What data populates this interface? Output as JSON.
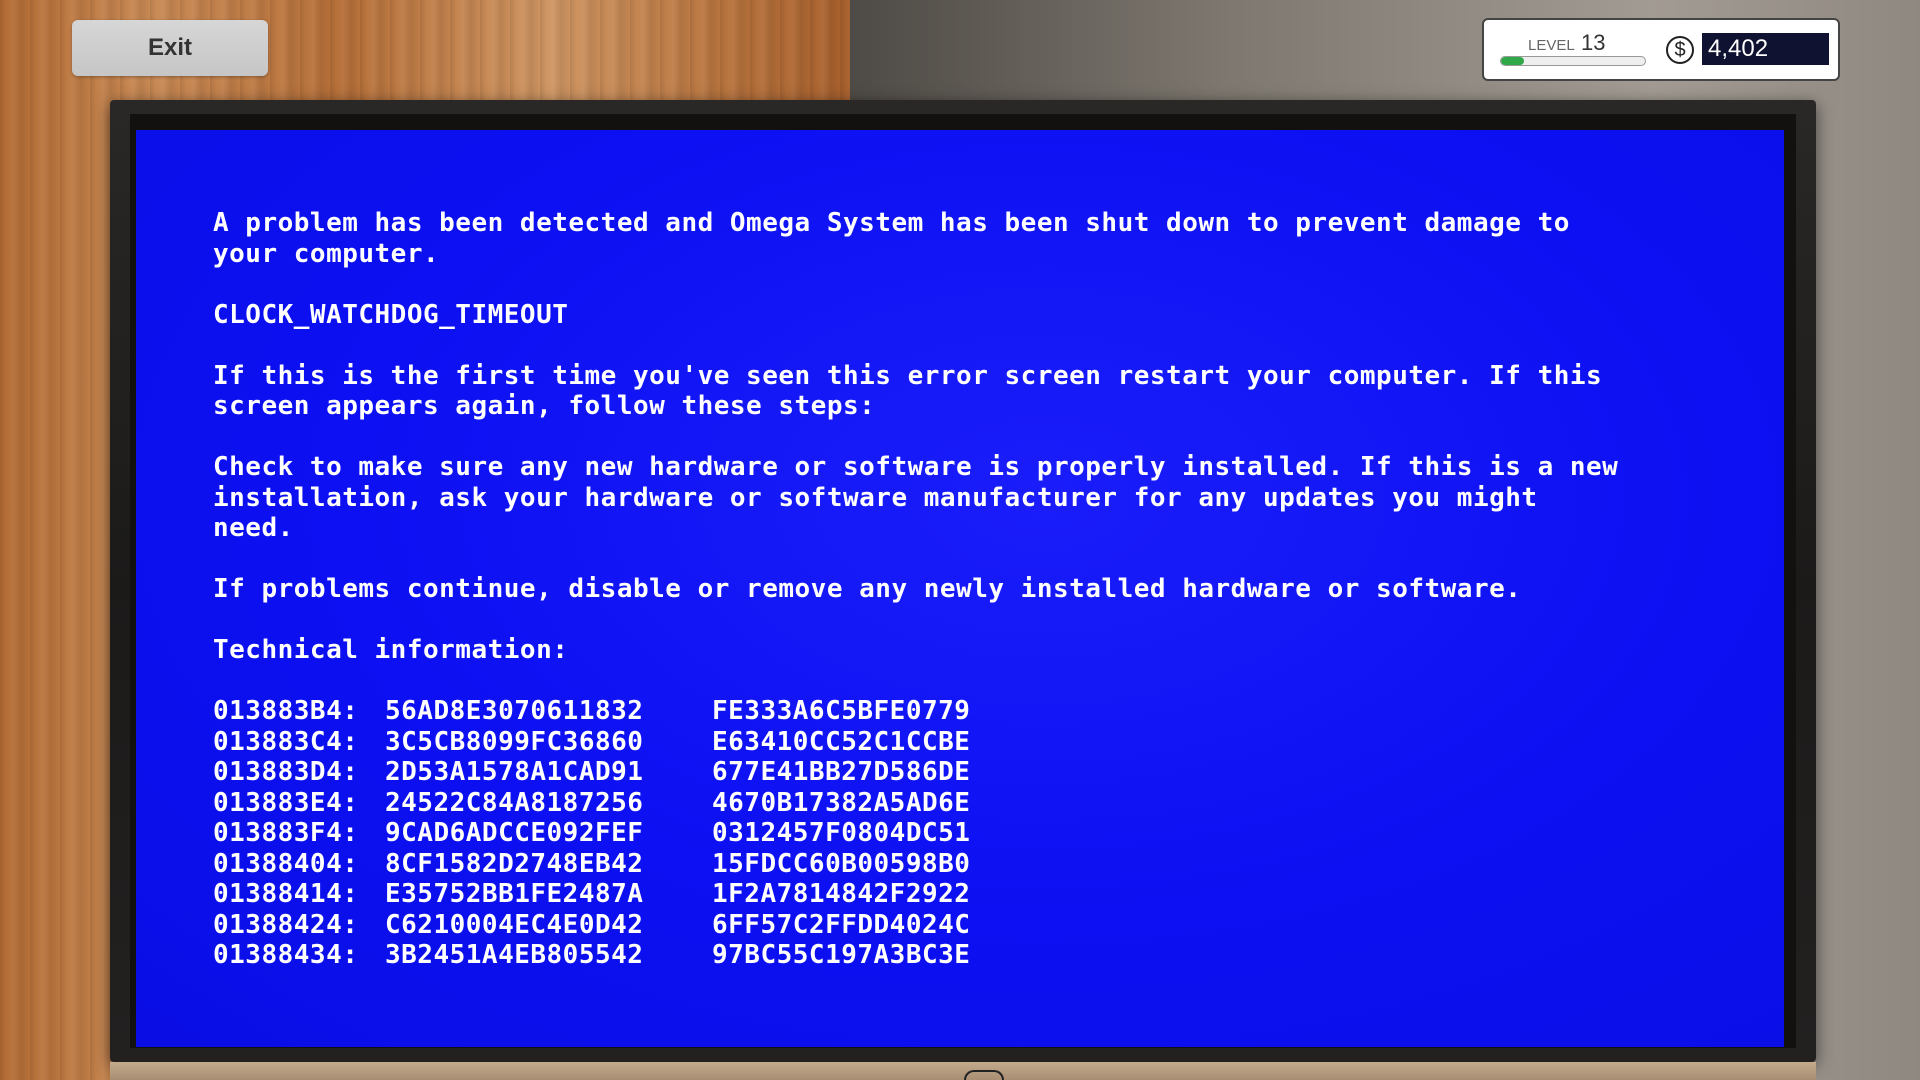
{
  "ui": {
    "exit_label": "Exit",
    "level_label": "LEVEL",
    "level_value": "13",
    "xp_progress": 0.16,
    "currency_icon": "dollar-icon",
    "money_value": "4,402"
  },
  "bsod": {
    "intro": "A problem has been detected and Omega System has been shut down to prevent damage to\nyour computer.",
    "error_code": "CLOCK_WATCHDOG_TIMEOUT",
    "first_time": "If this is the first time you've seen this error screen restart your computer. If this\nscreen appears again, follow these steps:",
    "check": "Check to make sure any new hardware or software is properly installed. If this is a new\ninstallation, ask your hardware or software manufacturer for any updates you might\nneed.",
    "problems": "If problems continue, disable or remove any newly installed hardware or software.",
    "tech_header": "Technical information:",
    "hex_rows": [
      {
        "addr": "013883B4:",
        "a": "56AD8E3070611832",
        "b": "FE333A6C5BFE0779"
      },
      {
        "addr": "013883C4:",
        "a": "3C5CB8099FC36860",
        "b": "E63410CC52C1CCBE"
      },
      {
        "addr": "013883D4:",
        "a": "2D53A1578A1CAD91",
        "b": "677E41BB27D586DE"
      },
      {
        "addr": "013883E4:",
        "a": "24522C84A8187256",
        "b": "4670B17382A5AD6E"
      },
      {
        "addr": "013883F4:",
        "a": "9CAD6ADCCE092FEF",
        "b": "0312457F0804DC51"
      },
      {
        "addr": "01388404:",
        "a": "8CF1582D2748EB42",
        "b": "15FDCC60B00598B0"
      },
      {
        "addr": "01388414:",
        "a": "E35752BB1FE2487A",
        "b": "1F2A7814842F2922"
      },
      {
        "addr": "01388424:",
        "a": "C6210004EC4E0D42",
        "b": "6FF57C2FFDD4024C"
      },
      {
        "addr": "01388434:",
        "a": "3B2451A4EB805542",
        "b": "97BC55C197A3BC3E"
      }
    ]
  }
}
